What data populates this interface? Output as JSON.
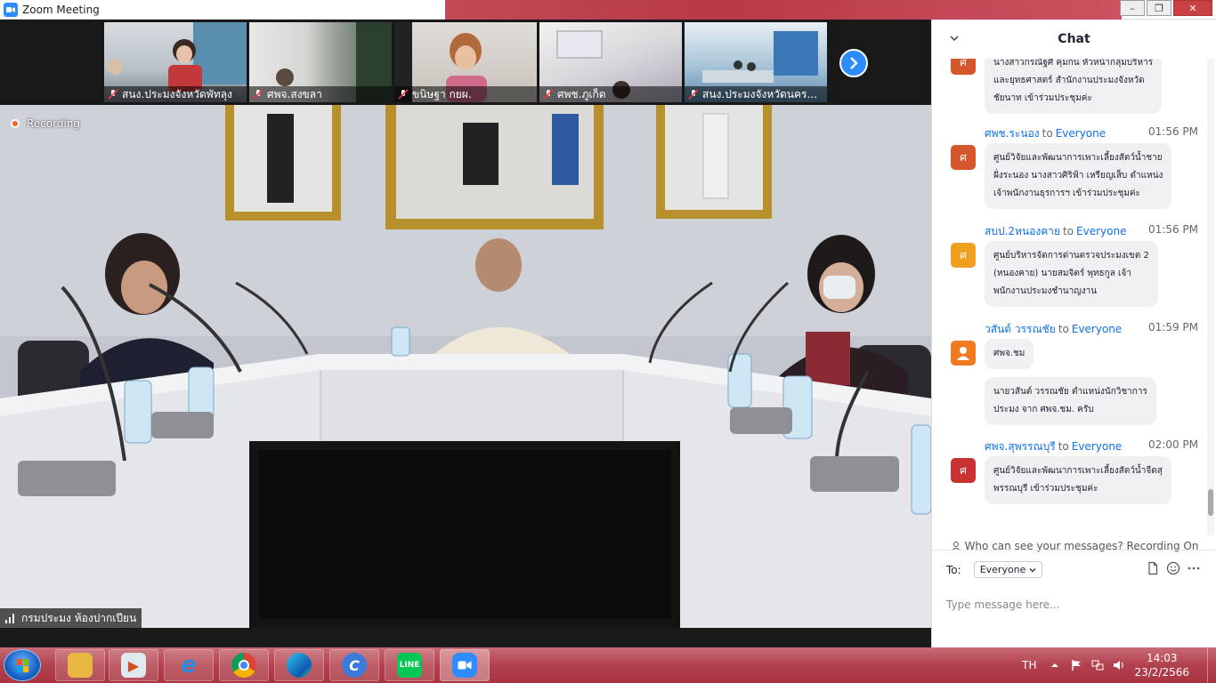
{
  "window": {
    "title": "Zoom Meeting"
  },
  "thumbnails": [
    {
      "name": "สนง.ประมงจังหวัดพัทลุง"
    },
    {
      "name": "ศพจ.สงขลา"
    },
    {
      "name": "ขนิษฐา กยผ."
    },
    {
      "name": "ศพช.ภูเก็ต"
    },
    {
      "name": "สนง.ประมงจังหวัดนคร..."
    }
  ],
  "main": {
    "recording_label": "Recording",
    "speaker_label": "กรมประมง ห้องปากเปียน"
  },
  "chat": {
    "title": "Chat",
    "messages": [
      {
        "sender": "",
        "to": "",
        "audience": "",
        "time": "",
        "avatar": "ศ",
        "color": "#d4562a",
        "lines": [
          "นางสาวกรณัฐศิ คุมกน หัวหน้ากลุ่มบริหาร",
          "และยุทธศาสตร์ สำนักงานประมงจังหวัด",
          "ชัยนาท เข้าร่วมประชุมค่ะ"
        ]
      },
      {
        "sender": "ศพช.ระนอง",
        "to": "to",
        "audience": "Everyone",
        "time": "01:56 PM",
        "avatar": "ศ",
        "color": "#d4562a",
        "lines": [
          "ศูนย์วิจัยและพัฒนาการเพาะเลี้ยงสัตว์น้ำชาย",
          "ฝั่งระนอง นางสาวศิริฟ้า เหรียญเส็บ ตำแหน่ง",
          "เจ้าพนักงานธุรการฯ เข้าร่วมประชุมค่ะ"
        ]
      },
      {
        "sender": "สบป.2หนองคาย",
        "to": "to",
        "audience": "Everyone",
        "time": "01:56 PM",
        "avatar": "ศ",
        "color": "#f0a020",
        "lines": [
          "ศูนย์บริหารจัดการด่านตรวจประมงเขต 2",
          "(หนองคาย) นายสมจิตร์ พุทธกูล เจ้า",
          "พนักงานประมงชำนาญงาน"
        ]
      },
      {
        "sender": "วสันต์ วรรณชัย",
        "to": "to",
        "audience": "Everyone",
        "time": "01:59 PM",
        "avatar": "person",
        "color": "#f07a20",
        "lines": [
          "ศพจ.ชม"
        ]
      },
      {
        "sender": "",
        "to": "",
        "audience": "",
        "time": "",
        "avatar": "",
        "color": "",
        "lines": [
          "นายวสันต์ วรรณชัย ตำแหน่งนักวิชาการ",
          "ประมง จาก ศพจ.ชม. ครับ"
        ]
      },
      {
        "sender": "ศพจ.สุพรรณบุรี",
        "to": "to",
        "audience": "Everyone",
        "time": "02:00 PM",
        "avatar": "ศ",
        "color": "#c83232",
        "lines": [
          "ศูนย์วิจัยและพัฒนาการเพาะเลี้ยงสัตว์น้ำจืดสุ",
          "พรรณบุรี เข้าร่วมประชุมค่ะ"
        ]
      }
    ],
    "privacy_note": "Who can see your messages? Recording On",
    "to_label": "To:",
    "recipient": "Everyone",
    "input_placeholder": "Type message here..."
  },
  "taskbar": {
    "language": "TH",
    "time": "14:03",
    "date": "23/2/2566"
  },
  "colors": {
    "accent": "#2d8cff",
    "link": "#0e71eb",
    "taskbar": "#b2414e"
  }
}
